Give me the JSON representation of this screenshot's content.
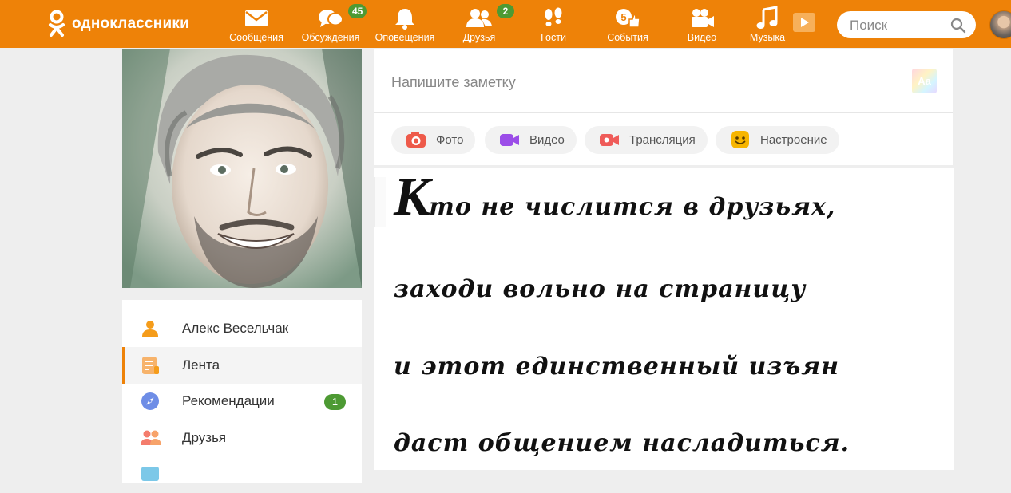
{
  "brand": {
    "name": "одноклассники"
  },
  "nav": {
    "messages": {
      "label": "Сообщения"
    },
    "discussions": {
      "label": "Обсуждения",
      "badge": "45"
    },
    "notifications": {
      "label": "Оповещения"
    },
    "friends": {
      "label": "Друзья",
      "badge": "2"
    },
    "guests": {
      "label": "Гости"
    },
    "events": {
      "label": "События",
      "icon_badge": "5"
    },
    "video": {
      "label": "Видео"
    },
    "music": {
      "label": "Музыка"
    }
  },
  "search": {
    "placeholder": "Поиск"
  },
  "profile": {
    "photo_icon": "profile-photo"
  },
  "sidebar": {
    "items": [
      {
        "label": "Алекс Весельчак",
        "icon": "user-icon"
      },
      {
        "label": "Лента",
        "icon": "feed-icon",
        "active": true
      },
      {
        "label": "Рекомендации",
        "icon": "compass-icon",
        "badge": "1"
      },
      {
        "label": "Друзья",
        "icon": "friends-icon"
      }
    ]
  },
  "composer": {
    "placeholder": "Напишите заметку",
    "font_button": "Aa",
    "actions": {
      "photo": "Фото",
      "video": "Видео",
      "stream": "Трансляция",
      "mood": "Настроение"
    }
  },
  "post": {
    "lines": [
      {
        "cap": "К",
        "rest": "то не числится в друзьях,"
      },
      {
        "text": "заходи вольно на страницу"
      },
      {
        "text": "и этот единственный изъян"
      },
      {
        "text": "даст общением насладиться."
      }
    ]
  },
  "colors": {
    "brand": "#ee8208",
    "badge": "#4d9a33"
  }
}
